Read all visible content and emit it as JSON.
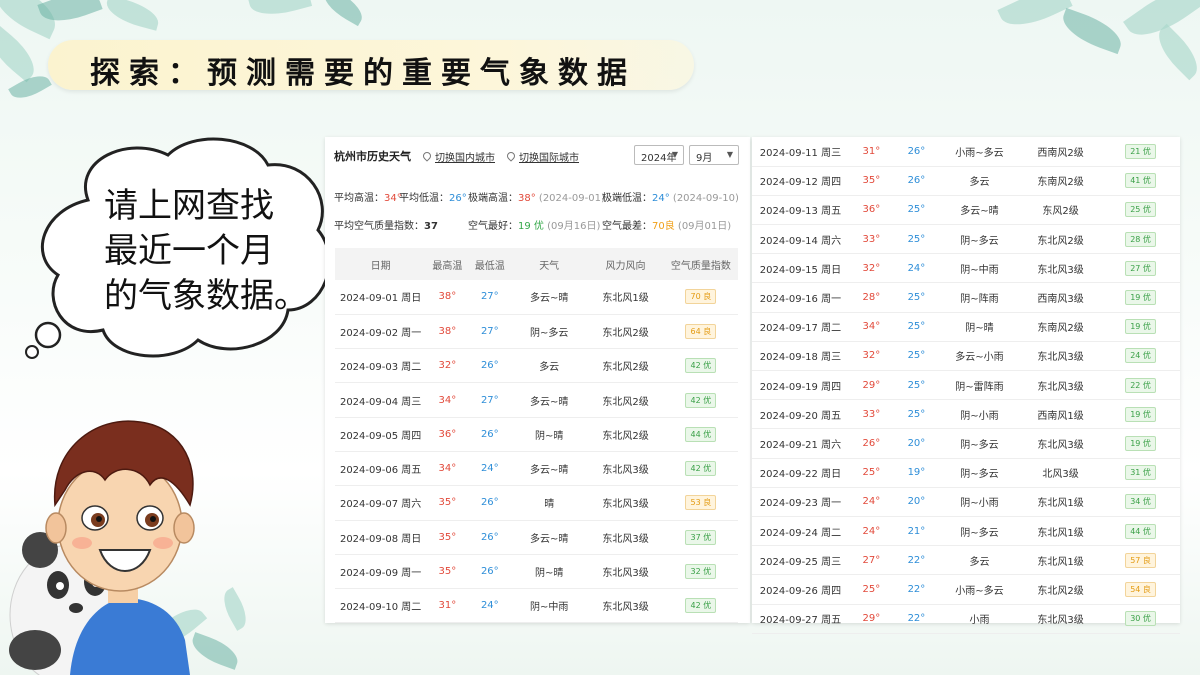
{
  "slide": {
    "title": "探索：预测需要的重要气象数据",
    "bubble_lines": [
      "请上网查找",
      "最近一个月",
      "的气象数据。"
    ]
  },
  "weather_page": {
    "city_title": "杭州市历史天气",
    "link_domestic": "切换国内城市",
    "link_international": "切换国际城市",
    "year_select": "2024年",
    "month_select": "9月",
    "stats": {
      "avg_high_label": "平均高温：",
      "avg_high": "34°",
      "avg_low_label": "平均低温：",
      "avg_low": "26°",
      "extreme_high_label": "极端高温：",
      "extreme_high": "38°",
      "extreme_high_date": "(2024-09-01)",
      "extreme_low_label": "极端低温：",
      "extreme_low": "24°",
      "extreme_low_date": "(2024-09-10)",
      "avg_aqi_label": "平均空气质量指数：",
      "avg_aqi": "37",
      "best_air_label": "空气最好：",
      "best_air": "19 优",
      "best_air_date": "(09月16日)",
      "worst_air_label": "空气最差：",
      "worst_air": "70良",
      "worst_air_date": "(09月01日)"
    },
    "columns": [
      "日期",
      "最高温",
      "最低温",
      "天气",
      "风力风向",
      "空气质量指数"
    ],
    "rows_left": [
      {
        "date": "2024-09-01 周日",
        "hi": "38°",
        "lo": "27°",
        "weather": "多云~晴",
        "wind": "东北风1级",
        "aqi": "70 良",
        "level": "mod"
      },
      {
        "date": "2024-09-02 周一",
        "hi": "38°",
        "lo": "27°",
        "weather": "阴~多云",
        "wind": "东北风2级",
        "aqi": "64 良",
        "level": "mod"
      },
      {
        "date": "2024-09-03 周二",
        "hi": "32°",
        "lo": "26°",
        "weather": "多云",
        "wind": "东北风2级",
        "aqi": "42 优",
        "level": "good"
      },
      {
        "date": "2024-09-04 周三",
        "hi": "34°",
        "lo": "27°",
        "weather": "多云~晴",
        "wind": "东北风2级",
        "aqi": "42 优",
        "level": "good"
      },
      {
        "date": "2024-09-05 周四",
        "hi": "36°",
        "lo": "26°",
        "weather": "阴~晴",
        "wind": "东北风2级",
        "aqi": "44 优",
        "level": "good"
      },
      {
        "date": "2024-09-06 周五",
        "hi": "34°",
        "lo": "24°",
        "weather": "多云~晴",
        "wind": "东北风3级",
        "aqi": "42 优",
        "level": "good"
      },
      {
        "date": "2024-09-07 周六",
        "hi": "35°",
        "lo": "26°",
        "weather": "晴",
        "wind": "东北风3级",
        "aqi": "53 良",
        "level": "mod"
      },
      {
        "date": "2024-09-08 周日",
        "hi": "35°",
        "lo": "26°",
        "weather": "多云~晴",
        "wind": "东北风3级",
        "aqi": "37 优",
        "level": "good"
      },
      {
        "date": "2024-09-09 周一",
        "hi": "35°",
        "lo": "26°",
        "weather": "阴~晴",
        "wind": "东北风3级",
        "aqi": "32 优",
        "level": "good"
      },
      {
        "date": "2024-09-10 周二",
        "hi": "31°",
        "lo": "24°",
        "weather": "阴~中雨",
        "wind": "东北风3级",
        "aqi": "42 优",
        "level": "good"
      }
    ],
    "rows_right": [
      {
        "date": "2024-09-11 周三",
        "hi": "31°",
        "lo": "26°",
        "weather": "小雨~多云",
        "wind": "西南风2级",
        "aqi": "21 优",
        "level": "good"
      },
      {
        "date": "2024-09-12 周四",
        "hi": "35°",
        "lo": "26°",
        "weather": "多云",
        "wind": "东南风2级",
        "aqi": "41 优",
        "level": "good"
      },
      {
        "date": "2024-09-13 周五",
        "hi": "36°",
        "lo": "25°",
        "weather": "多云~晴",
        "wind": "东风2级",
        "aqi": "25 优",
        "level": "good"
      },
      {
        "date": "2024-09-14 周六",
        "hi": "33°",
        "lo": "25°",
        "weather": "阴~多云",
        "wind": "东北风2级",
        "aqi": "28 优",
        "level": "good"
      },
      {
        "date": "2024-09-15 周日",
        "hi": "32°",
        "lo": "24°",
        "weather": "阴~中雨",
        "wind": "东北风3级",
        "aqi": "27 优",
        "level": "good"
      },
      {
        "date": "2024-09-16 周一",
        "hi": "28°",
        "lo": "25°",
        "weather": "阴~阵雨",
        "wind": "西南风3级",
        "aqi": "19 优",
        "level": "good"
      },
      {
        "date": "2024-09-17 周二",
        "hi": "34°",
        "lo": "25°",
        "weather": "阴~晴",
        "wind": "东南风2级",
        "aqi": "19 优",
        "level": "good"
      },
      {
        "date": "2024-09-18 周三",
        "hi": "32°",
        "lo": "25°",
        "weather": "多云~小雨",
        "wind": "东北风3级",
        "aqi": "24 优",
        "level": "good"
      },
      {
        "date": "2024-09-19 周四",
        "hi": "29°",
        "lo": "25°",
        "weather": "阴~雷阵雨",
        "wind": "东北风3级",
        "aqi": "22 优",
        "level": "good"
      },
      {
        "date": "2024-09-20 周五",
        "hi": "33°",
        "lo": "25°",
        "weather": "阴~小雨",
        "wind": "西南风1级",
        "aqi": "19 优",
        "level": "good"
      },
      {
        "date": "2024-09-21 周六",
        "hi": "26°",
        "lo": "20°",
        "weather": "阴~多云",
        "wind": "东北风3级",
        "aqi": "19 优",
        "level": "good"
      },
      {
        "date": "2024-09-22 周日",
        "hi": "25°",
        "lo": "19°",
        "weather": "阴~多云",
        "wind": "北风3级",
        "aqi": "31 优",
        "level": "good"
      },
      {
        "date": "2024-09-23 周一",
        "hi": "24°",
        "lo": "20°",
        "weather": "阴~小雨",
        "wind": "东北风1级",
        "aqi": "34 优",
        "level": "good"
      },
      {
        "date": "2024-09-24 周二",
        "hi": "24°",
        "lo": "21°",
        "weather": "阴~多云",
        "wind": "东北风1级",
        "aqi": "44 优",
        "level": "good"
      },
      {
        "date": "2024-09-25 周三",
        "hi": "27°",
        "lo": "22°",
        "weather": "多云",
        "wind": "东北风1级",
        "aqi": "57 良",
        "level": "mod"
      },
      {
        "date": "2024-09-26 周四",
        "hi": "25°",
        "lo": "22°",
        "weather": "小雨~多云",
        "wind": "东北风2级",
        "aqi": "54 良",
        "level": "mod"
      },
      {
        "date": "2024-09-27 周五",
        "hi": "29°",
        "lo": "22°",
        "weather": "小雨",
        "wind": "东北风3级",
        "aqi": "30 优",
        "level": "good"
      }
    ]
  },
  "colors": {
    "hi_temp": "#e24a3b",
    "lo_temp": "#2e8ed8",
    "aqi_good": "#3aa047",
    "aqi_moderate": "#e39b14",
    "title_pill": "#fbf3cf"
  }
}
